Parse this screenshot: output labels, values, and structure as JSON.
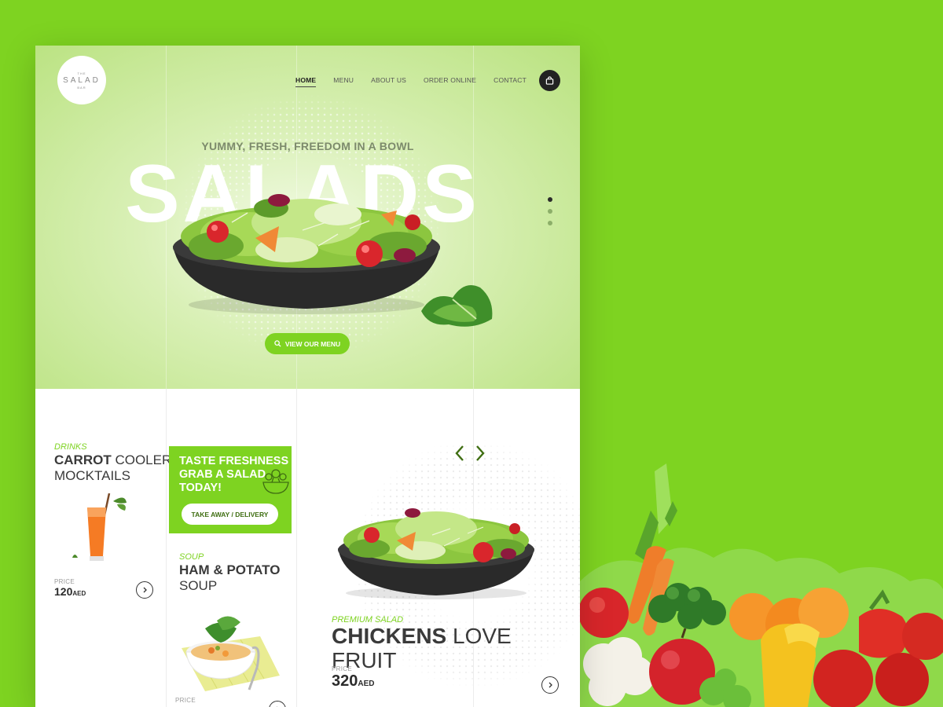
{
  "brand": {
    "top": "THE",
    "name": "SALAD",
    "bottom": "BAR"
  },
  "nav": [
    {
      "label": "HOME",
      "active": true
    },
    {
      "label": "MENU",
      "active": false
    },
    {
      "label": "ABOUT US",
      "active": false
    },
    {
      "label": "ORDER ONLINE",
      "active": false
    },
    {
      "label": "CONTACT",
      "active": false
    }
  ],
  "hero": {
    "tagline": "YUMMY, FRESH, FREEDOM IN A BOWL",
    "title": "SALADS",
    "cta_label": "VIEW OUR MENU",
    "slides": {
      "count": 3,
      "active": 1
    }
  },
  "drink": {
    "category": "DRINKS",
    "name_bold": "CARROT",
    "name_rest": " COOLER",
    "name_line2": "MOCKTAILS",
    "price_label": "PRICE",
    "price": "120",
    "currency": "AED"
  },
  "promo": {
    "line1": "TASTE FRESHNESS",
    "line2": "GRAB A SALAD",
    "line3": "TODAY!",
    "button": "TAKE AWAY / DELIVERY"
  },
  "soup": {
    "category": "SOUP",
    "name_line1": "HAM & POTATO",
    "name_line2": "SOUP",
    "price_label": "PRICE"
  },
  "featured": {
    "category": "PREMIUM SALAD",
    "name_bold": "CHICKENS",
    "name_rest": " LOVE FRUIT",
    "price_label": "PRICE",
    "price": "320",
    "currency": "AED"
  },
  "colors": {
    "brand_green": "#7ed321",
    "dark": "#2b2b2b"
  }
}
